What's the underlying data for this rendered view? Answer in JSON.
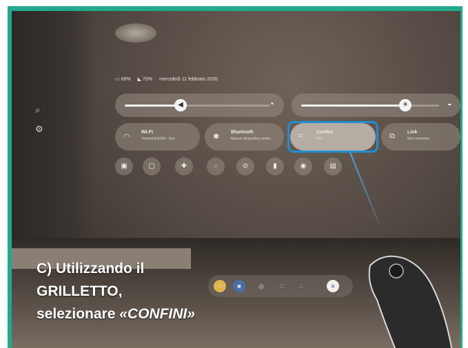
{
  "status_bar": {
    "battery_headset": "69%",
    "battery_controller": "70%",
    "datetime": "mercoledì 11 febbraio 2026"
  },
  "sliders": {
    "volume_level": 0.38,
    "brightness_level": 0.7
  },
  "tiles": [
    {
      "icon": "wifi-icon",
      "title": "Wi-Fi",
      "subtitle": "TechnoDESIGN - Dev"
    },
    {
      "icon": "bluetooth-icon",
      "title": "Bluetooth",
      "subtitle": "Nessun dispositivo conne..."
    },
    {
      "icon": "boundary-icon",
      "title": "Confini",
      "subtitle": "Fisi"
    },
    {
      "icon": "link-icon",
      "title": "Link",
      "subtitle": "Non connesso"
    }
  ],
  "caption": {
    "line1": "C) Utilizzando il",
    "line2": "GRILLETTO,",
    "line3_prefix": "selezionare ",
    "line3_emph": "«CONFINI»"
  },
  "colors": {
    "frame": "#21a98c",
    "highlight": "#1f8fd6"
  }
}
